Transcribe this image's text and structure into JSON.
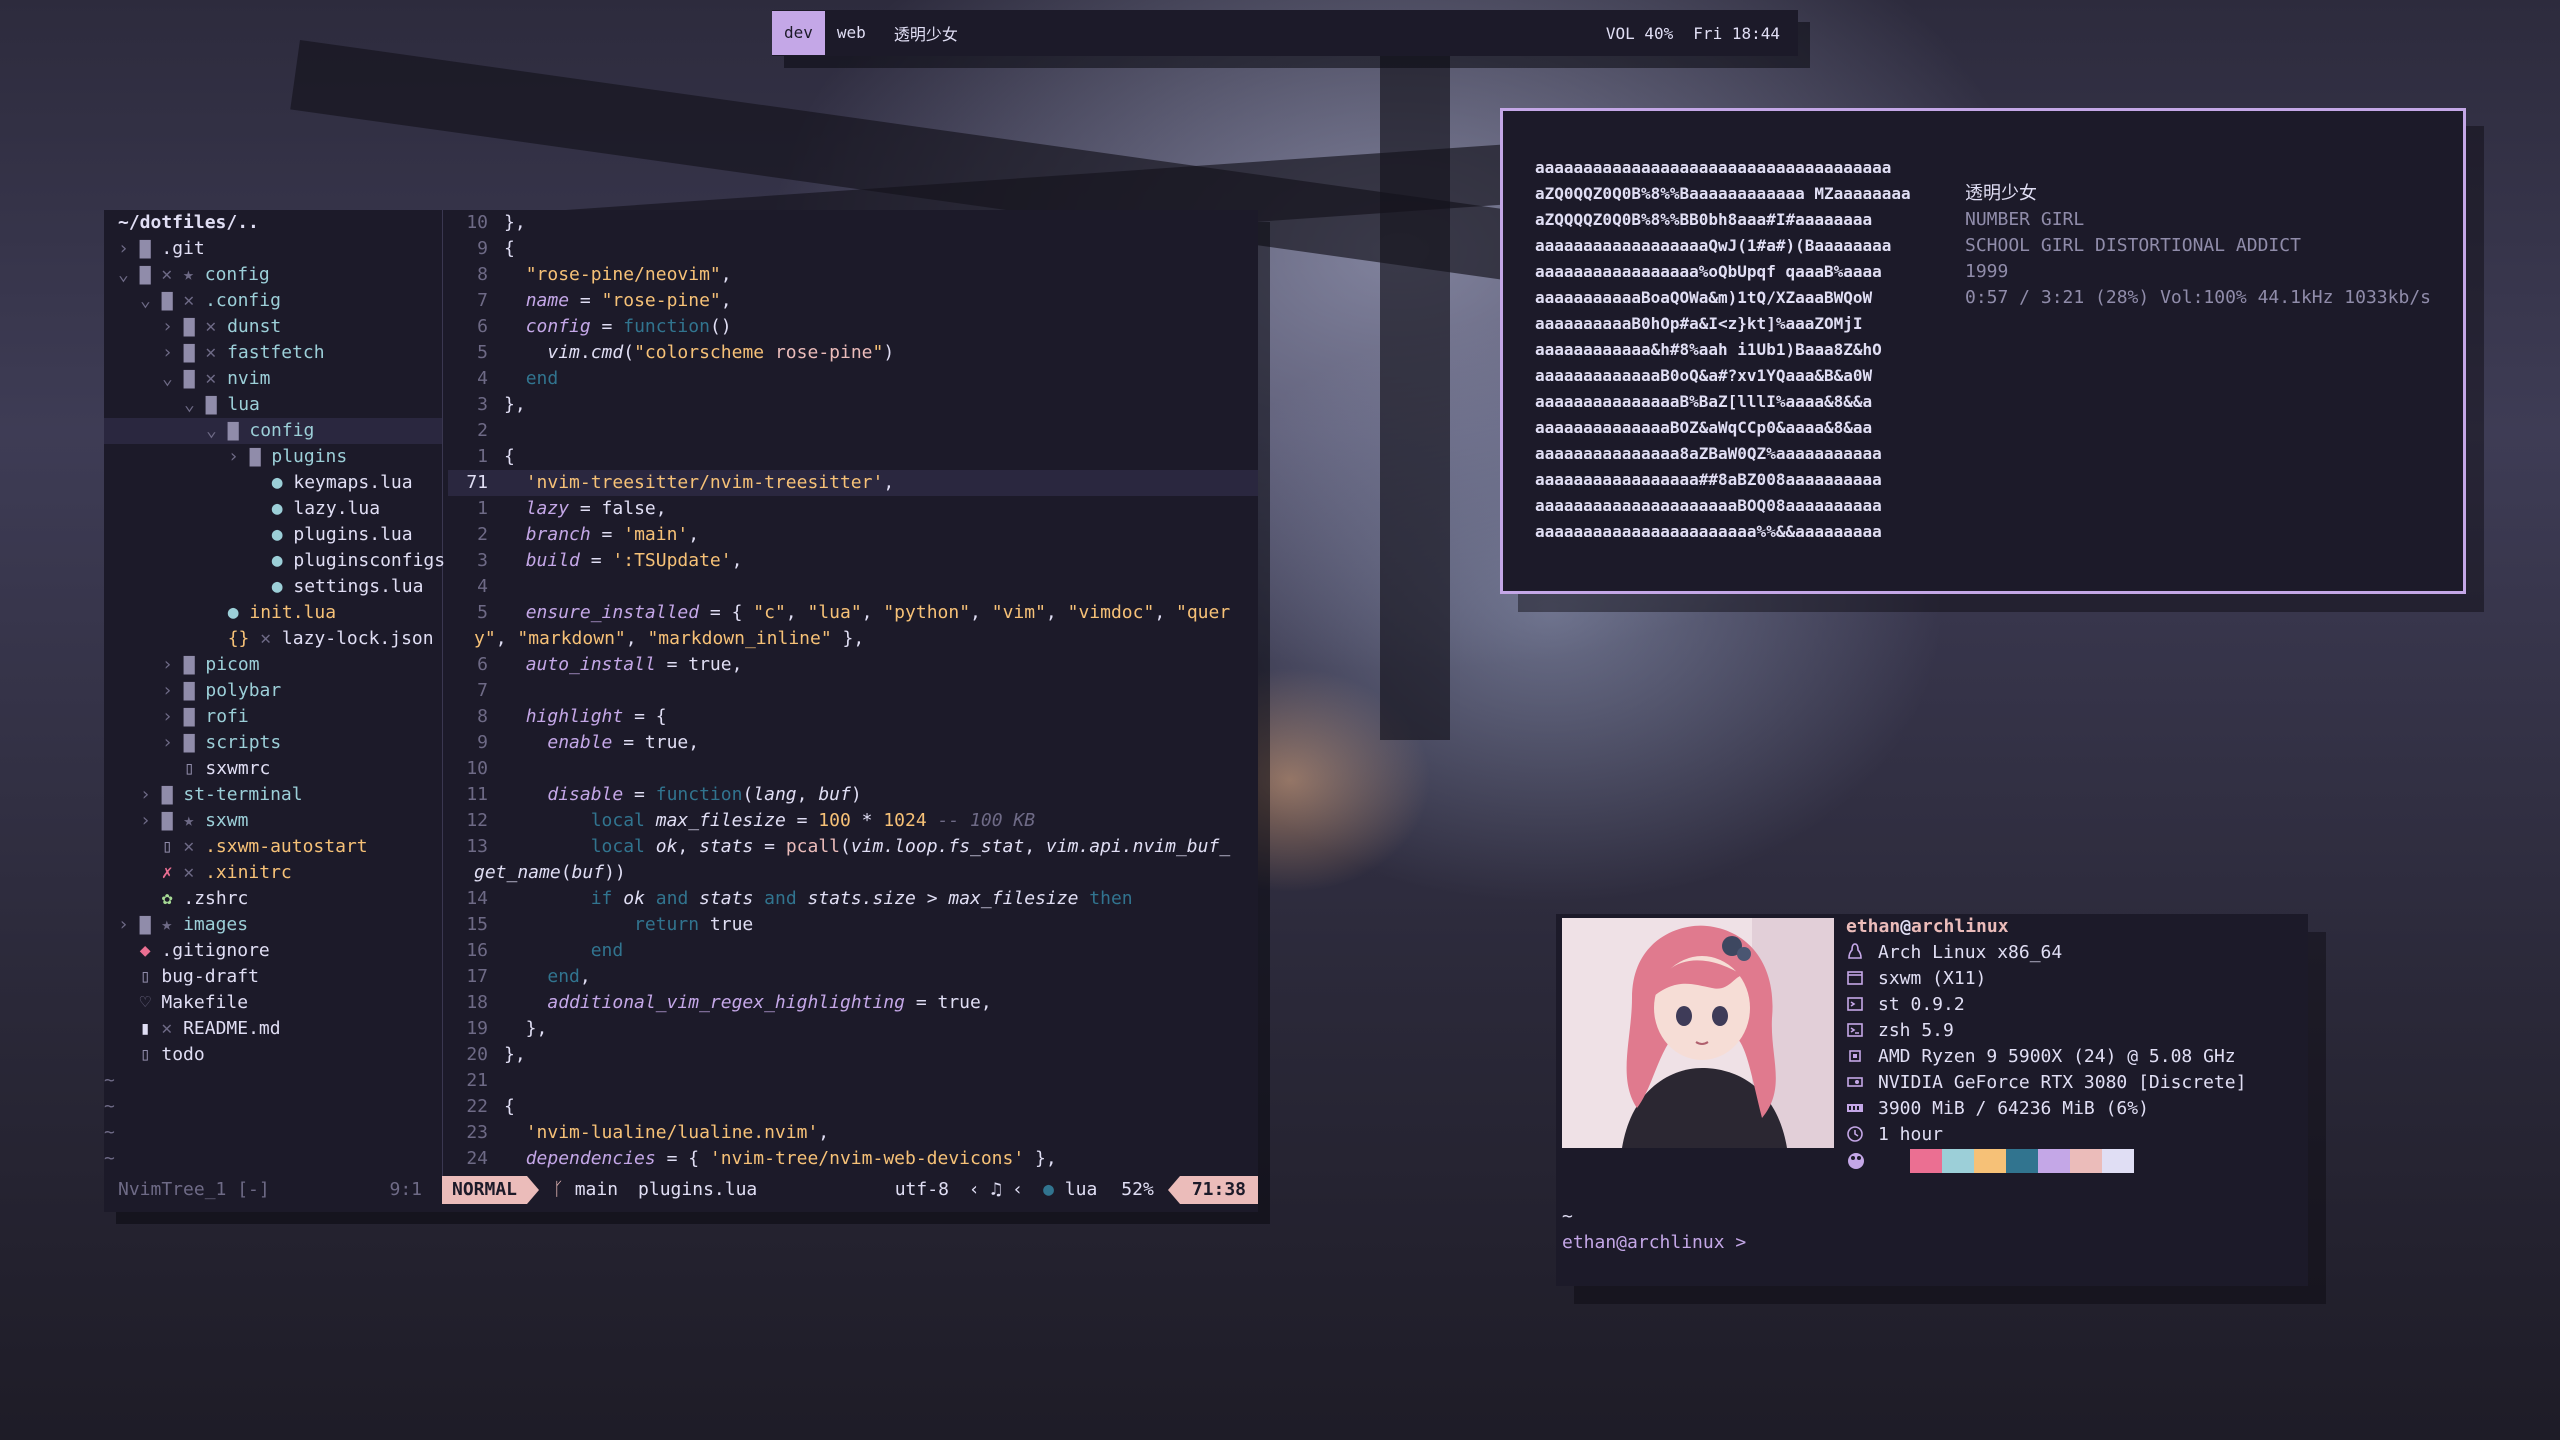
{
  "bar": {
    "workspaces": [
      {
        "label": "dev",
        "active": true
      },
      {
        "label": "web",
        "active": false
      }
    ],
    "title": "透明少女",
    "volume": "VOL 40%",
    "clock": "Fri 18:44"
  },
  "nvim": {
    "tree": [
      {
        "indent": 0,
        "chev": "",
        "icon": "",
        "mark": "",
        "name": "~/dotfiles/..",
        "color": "#e0def4",
        "bold": true
      },
      {
        "indent": 0,
        "chev": ">",
        "icon": "folder",
        "mark": "",
        "name": ".git",
        "color": "#e0def4"
      },
      {
        "indent": 0,
        "chev": "v",
        "icon": "folder-open",
        "mark": "✕ ★",
        "name": "config",
        "color": "#9ccfd8"
      },
      {
        "indent": 1,
        "chev": "v",
        "icon": "folder-open",
        "mark": "✕",
        "name": ".config",
        "color": "#9ccfd8"
      },
      {
        "indent": 2,
        "chev": ">",
        "icon": "folder",
        "mark": "✕",
        "name": "dunst",
        "color": "#9ccfd8"
      },
      {
        "indent": 2,
        "chev": ">",
        "icon": "folder",
        "mark": "✕",
        "name": "fastfetch",
        "color": "#9ccfd8"
      },
      {
        "indent": 2,
        "chev": "v",
        "icon": "folder-open",
        "mark": "✕",
        "name": "nvim",
        "color": "#9ccfd8"
      },
      {
        "indent": 3,
        "chev": "v",
        "icon": "folder-open",
        "mark": "",
        "name": "lua",
        "color": "#9ccfd8"
      },
      {
        "indent": 4,
        "chev": "v",
        "icon": "folder-open",
        "mark": "",
        "name": "config",
        "color": "#9ccfd8",
        "selected": true
      },
      {
        "indent": 5,
        "chev": ">",
        "icon": "folder",
        "mark": "",
        "name": "plugins",
        "color": "#9ccfd8"
      },
      {
        "indent": 6,
        "chev": "",
        "icon": "lua",
        "mark": "",
        "name": "keymaps.lua",
        "color": "#e0def4"
      },
      {
        "indent": 6,
        "chev": "",
        "icon": "lua",
        "mark": "",
        "name": "lazy.lua",
        "color": "#e0def4"
      },
      {
        "indent": 6,
        "chev": "",
        "icon": "lua",
        "mark": "",
        "name": "plugins.lua",
        "color": "#e0def4"
      },
      {
        "indent": 6,
        "chev": "",
        "icon": "lua",
        "mark": "",
        "name": "pluginsconfigs",
        "color": "#e0def4"
      },
      {
        "indent": 6,
        "chev": "",
        "icon": "lua",
        "mark": "",
        "name": "settings.lua",
        "color": "#e0def4"
      },
      {
        "indent": 4,
        "chev": "",
        "icon": "lua",
        "mark": "",
        "name": "init.lua",
        "color": "#f6c177"
      },
      {
        "indent": 4,
        "chev": "",
        "icon": "json",
        "mark": "✕",
        "name": "lazy-lock.json",
        "color": "#e0def4"
      },
      {
        "indent": 2,
        "chev": ">",
        "icon": "folder",
        "mark": "",
        "name": "picom",
        "color": "#9ccfd8"
      },
      {
        "indent": 2,
        "chev": ">",
        "icon": "folder",
        "mark": "",
        "name": "polybar",
        "color": "#9ccfd8"
      },
      {
        "indent": 2,
        "chev": ">",
        "icon": "folder",
        "mark": "",
        "name": "rofi",
        "color": "#9ccfd8"
      },
      {
        "indent": 2,
        "chev": ">",
        "icon": "folder",
        "mark": "",
        "name": "scripts",
        "color": "#9ccfd8"
      },
      {
        "indent": 2,
        "chev": "",
        "icon": "file",
        "mark": "",
        "name": "sxwmrc",
        "color": "#e0def4"
      },
      {
        "indent": 1,
        "chev": ">",
        "icon": "folder",
        "mark": "",
        "name": "st-terminal",
        "color": "#9ccfd8"
      },
      {
        "indent": 1,
        "chev": ">",
        "icon": "folder",
        "mark": "★",
        "name": "sxwm",
        "color": "#9ccfd8"
      },
      {
        "indent": 1,
        "chev": "",
        "icon": "file",
        "mark": "✕",
        "name": ".sxwm-autostart",
        "color": "#f6c177"
      },
      {
        "indent": 1,
        "chev": "",
        "icon": "x11",
        "mark": "✕",
        "name": ".xinitrc",
        "color": "#f6c177"
      },
      {
        "indent": 1,
        "chev": "",
        "icon": "gear",
        "mark": "",
        "name": ".zshrc",
        "color": "#e0def4"
      },
      {
        "indent": 0,
        "chev": ">",
        "icon": "folder",
        "mark": "★",
        "name": "images",
        "color": "#9ccfd8"
      },
      {
        "indent": 0,
        "chev": "",
        "icon": "git",
        "mark": "",
        "name": ".gitignore",
        "color": "#e0def4"
      },
      {
        "indent": 0,
        "chev": "",
        "icon": "file",
        "mark": "",
        "name": "bug-draft",
        "color": "#e0def4"
      },
      {
        "indent": 0,
        "chev": "",
        "icon": "make",
        "mark": "",
        "name": "Makefile",
        "color": "#e0def4"
      },
      {
        "indent": 0,
        "chev": "",
        "icon": "md",
        "mark": "✕",
        "name": "README.md",
        "color": "#e0def4"
      },
      {
        "indent": 0,
        "chev": "",
        "icon": "file",
        "mark": "",
        "name": "todo",
        "color": "#e0def4"
      }
    ],
    "tilde": "~",
    "tree_status": {
      "name": "NvimTree_1 [-]",
      "pos": "9:1"
    },
    "code_lines": [
      {
        "ln": "10",
        "segs": [
          [
            "",
            "},"
          ]
        ]
      },
      {
        "ln": "9",
        "segs": [
          [
            "",
            "{"
          ]
        ]
      },
      {
        "ln": "8",
        "segs": [
          [
            "",
            "  "
          ],
          [
            "str",
            "\"rose-pine/neovim\""
          ],
          [
            "",
            ","
          ]
        ]
      },
      {
        "ln": "7",
        "segs": [
          [
            "",
            "  "
          ],
          [
            "prop",
            "name"
          ],
          [
            "",
            " = "
          ],
          [
            "str",
            "\"rose-pine\""
          ],
          [
            "",
            ","
          ]
        ]
      },
      {
        "ln": "6",
        "segs": [
          [
            "",
            "  "
          ],
          [
            "prop",
            "config"
          ],
          [
            "",
            " = "
          ],
          [
            "kw",
            "function"
          ],
          [
            "",
            "()"
          ]
        ]
      },
      {
        "ln": "5",
        "segs": [
          [
            "",
            "    "
          ],
          [
            "var",
            "vim"
          ],
          [
            "",
            "."
          ],
          [
            "var",
            "cmd"
          ],
          [
            "",
            "("
          ],
          [
            "str",
            "\"colorscheme "
          ],
          [
            "fn",
            "rose-pine"
          ],
          [
            "str",
            "\""
          ],
          [
            "",
            ")"
          ]
        ]
      },
      {
        "ln": "4",
        "segs": [
          [
            "",
            "  "
          ],
          [
            "kw",
            "end"
          ]
        ]
      },
      {
        "ln": "3",
        "segs": [
          [
            "",
            "},"
          ]
        ]
      },
      {
        "ln": "2",
        "segs": [
          [
            "",
            ""
          ]
        ]
      },
      {
        "ln": "1",
        "segs": [
          [
            "",
            "{"
          ]
        ]
      },
      {
        "ln": "71",
        "cur": true,
        "segs": [
          [
            "",
            "  "
          ],
          [
            "str",
            "'nvim-treesitter/nvim-treesitter'"
          ],
          [
            "",
            ","
          ]
        ]
      },
      {
        "ln": "1",
        "segs": [
          [
            "",
            "  "
          ],
          [
            "prop",
            "lazy"
          ],
          [
            "",
            " = false,"
          ]
        ]
      },
      {
        "ln": "2",
        "segs": [
          [
            "",
            "  "
          ],
          [
            "prop",
            "branch"
          ],
          [
            "",
            " = "
          ],
          [
            "str",
            "'main'"
          ],
          [
            "",
            ","
          ]
        ]
      },
      {
        "ln": "3",
        "segs": [
          [
            "",
            "  "
          ],
          [
            "prop",
            "build"
          ],
          [
            "",
            " = "
          ],
          [
            "str",
            "':TSUpdate'"
          ],
          [
            "",
            ","
          ]
        ]
      },
      {
        "ln": "4",
        "segs": [
          [
            "",
            ""
          ]
        ]
      },
      {
        "ln": "5",
        "segs": [
          [
            "",
            "  "
          ],
          [
            "prop",
            "ensure_installed"
          ],
          [
            "",
            " = { "
          ],
          [
            "str",
            "\"c\""
          ],
          [
            "",
            ", "
          ],
          [
            "str",
            "\"lua\""
          ],
          [
            "",
            ", "
          ],
          [
            "str",
            "\"python\""
          ],
          [
            "",
            ", "
          ],
          [
            "str",
            "\"vim\""
          ],
          [
            "",
            ", "
          ],
          [
            "str",
            "\"vimdoc\""
          ],
          [
            "",
            ", "
          ],
          [
            "str",
            "\"quer"
          ]
        ]
      },
      {
        "ln": "",
        "segs": [
          [
            "str",
            "y\""
          ],
          [
            "",
            ", "
          ],
          [
            "str",
            "\"markdown\""
          ],
          [
            "",
            ", "
          ],
          [
            "str",
            "\"markdown_inline\""
          ],
          [
            "",
            " },"
          ]
        ]
      },
      {
        "ln": "6",
        "segs": [
          [
            "",
            "  "
          ],
          [
            "prop",
            "auto_install"
          ],
          [
            "",
            " = true,"
          ]
        ]
      },
      {
        "ln": "7",
        "segs": [
          [
            "",
            ""
          ]
        ]
      },
      {
        "ln": "8",
        "segs": [
          [
            "",
            "  "
          ],
          [
            "prop",
            "highlight"
          ],
          [
            "",
            " = {"
          ]
        ]
      },
      {
        "ln": "9",
        "segs": [
          [
            "",
            "    "
          ],
          [
            "prop",
            "enable"
          ],
          [
            "",
            " = true,"
          ]
        ]
      },
      {
        "ln": "10",
        "segs": [
          [
            "",
            ""
          ]
        ]
      },
      {
        "ln": "11",
        "segs": [
          [
            "",
            "    "
          ],
          [
            "prop",
            "disable"
          ],
          [
            "",
            " = "
          ],
          [
            "kw",
            "function"
          ],
          [
            "",
            "("
          ],
          [
            "var",
            "lang"
          ],
          [
            "",
            ", "
          ],
          [
            "var",
            "buf"
          ],
          [
            "",
            ")"
          ]
        ]
      },
      {
        "ln": "12",
        "segs": [
          [
            "",
            "        "
          ],
          [
            "kw",
            "local"
          ],
          [
            "",
            " "
          ],
          [
            "var",
            "max_filesize"
          ],
          [
            "",
            " = "
          ],
          [
            "num",
            "100"
          ],
          [
            "",
            " * "
          ],
          [
            "num",
            "1024"
          ],
          [
            "",
            " "
          ],
          [
            "cm",
            "-- 100 KB"
          ]
        ]
      },
      {
        "ln": "13",
        "segs": [
          [
            "",
            "        "
          ],
          [
            "kw",
            "local"
          ],
          [
            "",
            " "
          ],
          [
            "var",
            "ok"
          ],
          [
            "",
            ", "
          ],
          [
            "var",
            "stats"
          ],
          [
            "",
            " = "
          ],
          [
            "fn",
            "pcall"
          ],
          [
            "",
            "("
          ],
          [
            "var",
            "vim.loop.fs_stat"
          ],
          [
            "",
            ", "
          ],
          [
            "var",
            "vim.api.nvim_buf_"
          ]
        ]
      },
      {
        "ln": "",
        "segs": [
          [
            "var",
            "get_name"
          ],
          [
            "",
            "("
          ],
          [
            "var",
            "buf"
          ],
          [
            "",
            "))"
          ]
        ]
      },
      {
        "ln": "14",
        "segs": [
          [
            "",
            "        "
          ],
          [
            "kw",
            "if"
          ],
          [
            "",
            " "
          ],
          [
            "var",
            "ok"
          ],
          [
            "",
            " "
          ],
          [
            "kw",
            "and"
          ],
          [
            "",
            " "
          ],
          [
            "var",
            "stats"
          ],
          [
            "",
            " "
          ],
          [
            "kw",
            "and"
          ],
          [
            "",
            " "
          ],
          [
            "var",
            "stats.size"
          ],
          [
            "",
            " > "
          ],
          [
            "var",
            "max_filesize"
          ],
          [
            "",
            " "
          ],
          [
            "kw",
            "then"
          ]
        ]
      },
      {
        "ln": "15",
        "segs": [
          [
            "",
            "            "
          ],
          [
            "kw",
            "return"
          ],
          [
            "",
            " true"
          ]
        ]
      },
      {
        "ln": "16",
        "segs": [
          [
            "",
            "        "
          ],
          [
            "kw",
            "end"
          ]
        ]
      },
      {
        "ln": "17",
        "segs": [
          [
            "",
            "    "
          ],
          [
            "kw",
            "end"
          ],
          [
            "",
            ","
          ]
        ]
      },
      {
        "ln": "18",
        "segs": [
          [
            "",
            "    "
          ],
          [
            "prop",
            "additional_vim_regex_highlighting"
          ],
          [
            "",
            " = true,"
          ]
        ]
      },
      {
        "ln": "19",
        "segs": [
          [
            "",
            "  },"
          ]
        ]
      },
      {
        "ln": "20",
        "segs": [
          [
            "",
            "},"
          ]
        ]
      },
      {
        "ln": "21",
        "segs": [
          [
            "",
            ""
          ]
        ]
      },
      {
        "ln": "22",
        "segs": [
          [
            "",
            "{"
          ]
        ]
      },
      {
        "ln": "23",
        "segs": [
          [
            "",
            "  "
          ],
          [
            "str",
            "'nvim-lualine/lualine.nvim'"
          ],
          [
            "",
            ","
          ]
        ]
      },
      {
        "ln": "24",
        "segs": [
          [
            "",
            "  "
          ],
          [
            "prop",
            "dependencies"
          ],
          [
            "",
            " = { "
          ],
          [
            "str",
            "'nvim-tree/nvim-web-devicons'"
          ],
          [
            "",
            " },"
          ]
        ]
      }
    ],
    "status": {
      "mode": "NORMAL",
      "branch": "main",
      "file": "plugins.lua",
      "encoding": "utf-8",
      "filetype": "lua",
      "percent": "52%",
      "position": "71:38"
    }
  },
  "music": {
    "ascii": [
      "aaaaaaaaaaaaaaaaaaaaaaaaaaaaaaaaaaaaa",
      "aZQ0QQZ0Q0B%8%%Baaaaaaaaaaaa MZaaaaaaaa",
      "aZQQQQZ0Q0B%8%%BB0bh8aaa#I#aaaaaaaa",
      "aaaaaaaaaaaaaaaaaaQwJ(1#a#)(Baaaaaaaa",
      "aaaaaaaaaaaaaaaaa%oQbUpqf qaaaB%aaaa",
      "aaaaaaaaaaaBoaQOWa&m)1tQ/XZaaaBWQoW",
      "aaaaaaaaaaB0hOp#a&I<z}kt]%aaaZOMjI",
      "aaaaaaaaaaaa&h#8%aah i1Ub1)Baaa8Z&hO",
      "aaaaaaaaaaaaaB0oQ&a#?xv1YQaaa&B&a0W",
      "aaaaaaaaaaaaaaaB%BaZ[lllI%aaaa&8&&a",
      "aaaaaaaaaaaaaaBOZ&aWqCCp0&aaaa&8&aa",
      "aaaaaaaaaaaaaaa8aZBaW0QZ%aaaaaaaaaaa",
      "aaaaaaaaaaaaaaaaa##8aBZ008aaaaaaaaaa",
      "aaaaaaaaaaaaaaaaaaaaaBOQ08aaaaaaaaaa",
      "aaaaaaaaaaaaaaaaaaaaaaa%%&&aaaaaaaaa"
    ],
    "title": "透明少女",
    "artist": "NUMBER GIRL",
    "album": "SCHOOL GIRL DISTORTIONAL ADDICT",
    "year": "1999",
    "progress": "0:57 / 3:21 (28%) Vol:100% 44.1kHz 1033kb/s"
  },
  "fetch": {
    "user": "ethan",
    "at": "@",
    "host": "archlinux",
    "rows": [
      {
        "icon": "tux-icon",
        "text": "Arch Linux x86_64"
      },
      {
        "icon": "window-icon",
        "text": "sxwm (X11)"
      },
      {
        "icon": "terminal-icon",
        "text": "st 0.9.2"
      },
      {
        "icon": "shell-icon",
        "text": "zsh 5.9"
      },
      {
        "icon": "cpu-icon",
        "text": "AMD Ryzen 9 5900X (24) @ 5.08 GHz"
      },
      {
        "icon": "gpu-icon",
        "text": "NVIDIA GeForce RTX 3080 [Discrete]"
      },
      {
        "icon": "memory-icon",
        "text": "3900 MiB / 64236 MiB (6%)"
      },
      {
        "icon": "clock-icon",
        "text": "1 hour"
      }
    ],
    "palette": [
      "#1c1a29",
      "#eb6f92",
      "#9ccfd8",
      "#f6c177",
      "#31748f",
      "#c4a7e7",
      "#ebbcba",
      "#e0def4"
    ],
    "prompt_tilde": "~",
    "prompt": "ethan@archlinux >"
  }
}
